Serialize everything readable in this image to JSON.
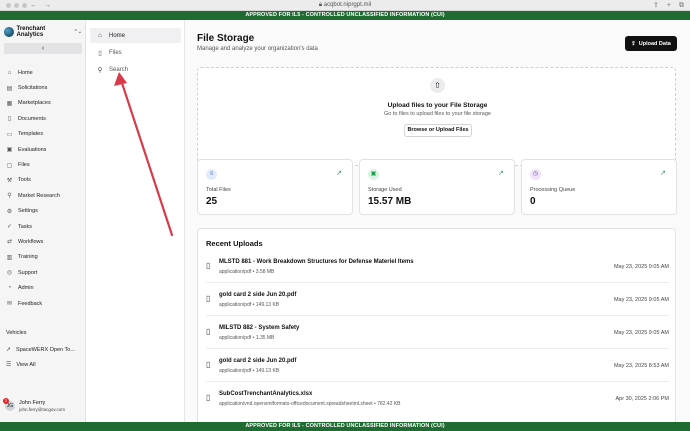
{
  "browser": {
    "url": "acqbot.niprgpt.mil",
    "back_icon": "arrow-left",
    "forward_icon": "arrow-right"
  },
  "banner": {
    "top": "APPROVED FOR IL5 - CONTROLLED UNCLASSIFIED INFORMATION (CUI)",
    "bottom": "APPROVED FOR IL5 - CONTROLLED UNCLASSIFIED INFORMATION (CUI)",
    "color": "#1f6b31"
  },
  "sidebar": {
    "org_name": "Trenchant Analytics",
    "collapse_glyph": "‹",
    "items": [
      {
        "label": "Home",
        "icon": "home-icon"
      },
      {
        "label": "Solicitations",
        "icon": "document-icon"
      },
      {
        "label": "Marketplaces",
        "icon": "store-icon"
      },
      {
        "label": "Documents",
        "icon": "file-icon"
      },
      {
        "label": "Templates",
        "icon": "template-icon"
      },
      {
        "label": "Evaluations",
        "icon": "clipboard-icon"
      },
      {
        "label": "Files",
        "icon": "folder-icon"
      },
      {
        "label": "Tools",
        "icon": "wrench-icon"
      },
      {
        "label": "Market Research",
        "icon": "search-icon"
      },
      {
        "label": "Settings",
        "icon": "gear-icon"
      },
      {
        "label": "Tasks",
        "icon": "check-icon"
      },
      {
        "label": "Workflows",
        "icon": "flow-icon"
      },
      {
        "label": "Training",
        "icon": "book-icon"
      },
      {
        "label": "Support",
        "icon": "help-icon"
      },
      {
        "label": "Admin",
        "icon": "user-icon"
      },
      {
        "label": "Feedback",
        "icon": "chat-icon"
      }
    ],
    "vehicles_label": "Vehicles",
    "vehicles": [
      {
        "label": "SpaceWERX Open To..."
      },
      {
        "label": "View All"
      }
    ],
    "user": {
      "name": "John Ferry",
      "email": "john.ferry@tacgov.com",
      "initials": "JG",
      "badge": "2"
    }
  },
  "subnav": {
    "items": [
      {
        "label": "Home",
        "icon": "home-icon",
        "active": true
      },
      {
        "label": "Files",
        "icon": "file-icon",
        "active": false
      },
      {
        "label": "Search",
        "icon": "search-icon",
        "active": false
      }
    ]
  },
  "main": {
    "title": "File Storage",
    "subtitle": "Manage and analyze your organization's data",
    "upload_button": "Upload Data",
    "dropzone": {
      "title": "Upload files to your File Storage",
      "subtitle": "Go to files to upload files to your file storage",
      "button": "Browse or Upload Files"
    },
    "stats": [
      {
        "label": "Total Files",
        "value": "25",
        "icon": "database-icon",
        "color": "#3b6fd4"
      },
      {
        "label": "Storage Used",
        "value": "15.57 MB",
        "icon": "hard-drive-icon",
        "color": "#1f9e4a"
      },
      {
        "label": "Processing Queue",
        "value": "0",
        "icon": "clock-icon",
        "color": "#8b3fc4"
      }
    ],
    "recent_title": "Recent Uploads",
    "uploads": [
      {
        "name": "MLSTD 881 - Work Breakdown Structures for Defense Materiel Items",
        "meta": "application/pdf • 3.58 MB",
        "date": "May 23, 2025 9:05 AM"
      },
      {
        "name": "gold card 2 side Jun 20.pdf",
        "meta": "application/pdf • 149.13 KB",
        "date": "May 23, 2025 9:05 AM"
      },
      {
        "name": "MILSTD 882 - System Safety",
        "meta": "application/pdf • 1.35 MB",
        "date": "May 23, 2025 9:05 AM"
      },
      {
        "name": "gold card 2 side Jun 20.pdf",
        "meta": "application/pdf • 149.13 KB",
        "date": "May 23, 2025 8:53 AM"
      },
      {
        "name": "SubCostTrenchantAnalytics.xlsx",
        "meta": "application/vnd.openxmlformats-officedocument.spreadsheetml.sheet • 782.42 KB",
        "date": "Apr 30, 2025 2:06 PM"
      }
    ]
  },
  "annotation": {
    "color": "#d93a4a"
  }
}
